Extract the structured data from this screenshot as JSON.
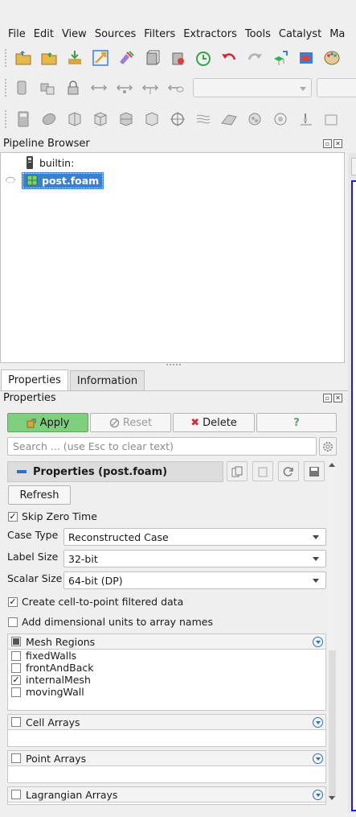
{
  "menubar": {
    "items": [
      "File",
      "Edit",
      "View",
      "Sources",
      "Filters",
      "Extractors",
      "Tools",
      "Catalyst",
      "Ma"
    ]
  },
  "toolbar1": {
    "icons": [
      "open-folder-icon",
      "load-state-icon",
      "save-data-icon",
      "connect-icon",
      "disconnect-icon",
      "macro-icon",
      "delete-macro-icon",
      "timer-icon",
      "undo-icon",
      "redo-icon",
      "reset-camera-icon",
      "screenshot-icon",
      "palette-icon"
    ]
  },
  "toolbar2": {
    "icons": [
      "cylinder-icon",
      "boxes-icon",
      "lock-icon",
      "arrow-x-icon",
      "arrow-y-icon",
      "arrow-z-icon",
      "eye-icon"
    ]
  },
  "toolbar3": {
    "icons": [
      "calculator-icon",
      "contour-icon",
      "clip-icon",
      "slice-icon",
      "threshold-icon",
      "extract-icon",
      "glyph-icon",
      "stream-icon",
      "warp-icon",
      "group-icon",
      "extract-level-icon",
      "probe-icon"
    ]
  },
  "pipeline_browser": {
    "title": "Pipeline Browser",
    "items": [
      {
        "label": "builtin:",
        "selected": false
      },
      {
        "label": "post.foam",
        "selected": true
      }
    ]
  },
  "tabs": [
    {
      "label": "Properties",
      "active": true
    },
    {
      "label": "Information",
      "active": false
    }
  ],
  "properties_panel": {
    "title": "Properties",
    "apply_label": "Apply",
    "reset_label": "Reset",
    "delete_label": "Delete",
    "help_label": "?",
    "search_placeholder": "Search ... (use Esc to clear text)",
    "section_title": "Properties (post.foam)",
    "refresh_label": "Refresh",
    "skip_zero_time_label": "Skip Zero Time",
    "skip_zero_time_checked": true,
    "case_type_label": "Case Type",
    "case_type_value": "Reconstructed Case",
    "label_size_label": "Label Size",
    "label_size_value": "32-bit",
    "scalar_size_label": "Scalar Size",
    "scalar_size_value": "64-bit (DP)",
    "cell_to_point_label": "Create cell-to-point filtered data",
    "cell_to_point_checked": true,
    "dimensional_units_label": "Add dimensional units to array names",
    "dimensional_units_checked": false,
    "mesh_regions": {
      "title": "Mesh Regions",
      "items": [
        {
          "label": "fixedWalls",
          "checked": false
        },
        {
          "label": "frontAndBack",
          "checked": false
        },
        {
          "label": "internalMesh",
          "checked": true
        },
        {
          "label": "movingWall",
          "checked": false
        }
      ]
    },
    "cell_arrays_title": "Cell Arrays",
    "point_arrays_title": "Point Arrays",
    "lagrangian_arrays_title": "Lagrangian Arrays"
  },
  "colors": {
    "apply": "#7fcf7f",
    "selection": "#3a80d2",
    "accent": "#2a6fc4",
    "delete_x": "#d32f2f",
    "view_frame": "#1d1dcf"
  }
}
